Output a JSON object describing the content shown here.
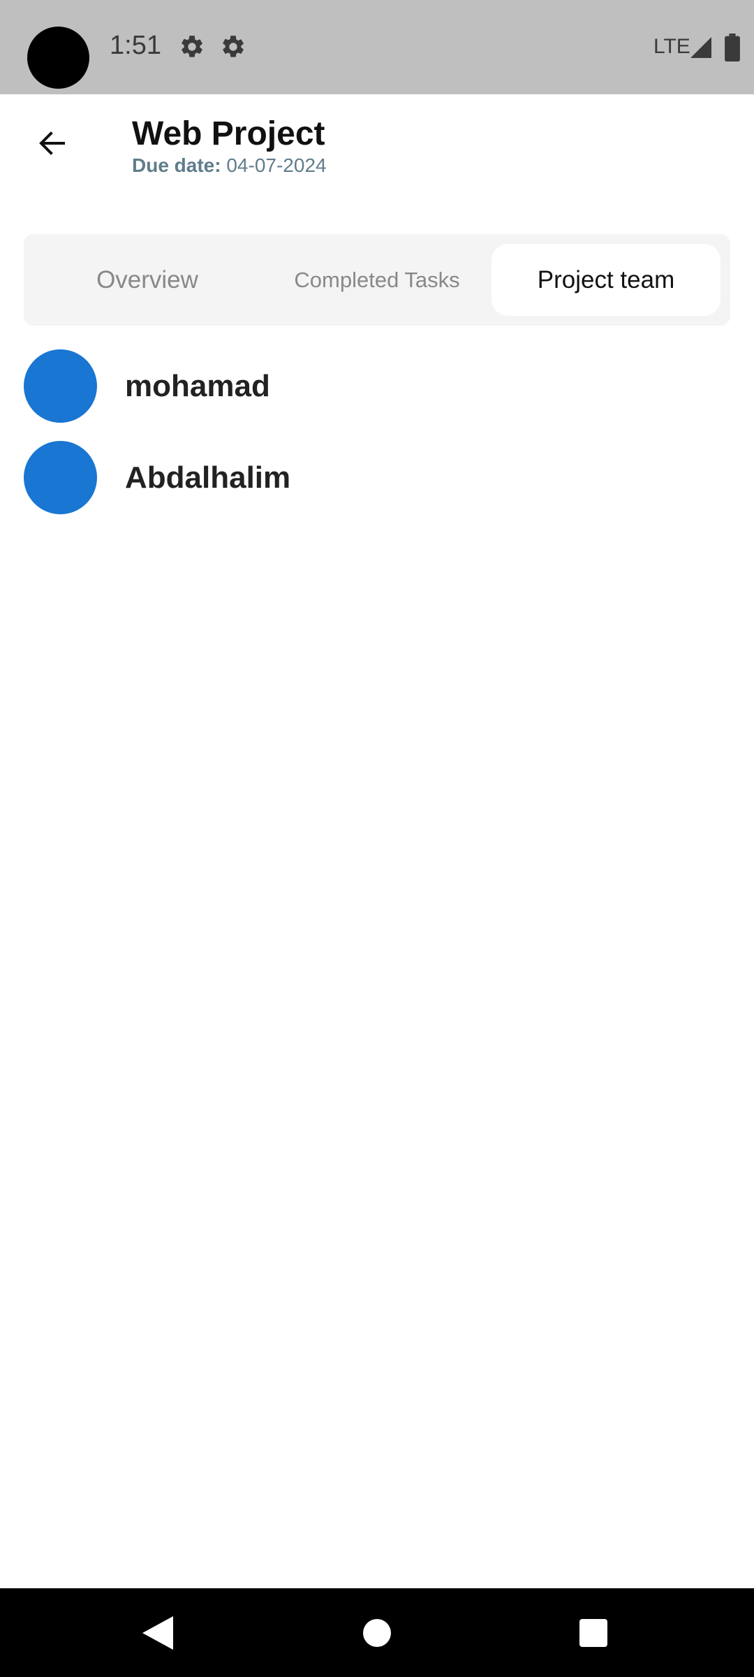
{
  "status_bar": {
    "time": "1:51",
    "network": "LTE",
    "icons": [
      "settings-icon",
      "settings-icon",
      "signal-icon",
      "battery-icon"
    ]
  },
  "header": {
    "title": "Web Project",
    "due_label": "Due date:",
    "due_value": "04-07-2024",
    "back_icon": "arrow-left-icon"
  },
  "tabs": [
    {
      "label": "Overview",
      "selected": false
    },
    {
      "label": "Completed Tasks",
      "selected": false
    },
    {
      "label": "Project team",
      "selected": true
    }
  ],
  "team": {
    "members": [
      {
        "name": "mohamad"
      },
      {
        "name": "Abdalhalim"
      }
    ]
  },
  "nav_bar": {
    "icons": [
      "nav-back-icon",
      "nav-home-icon",
      "nav-recents-icon"
    ]
  },
  "colors": {
    "status_bar_bg": "#bfbfbf",
    "avatar": "#1976d2",
    "due_text": "#607d8b",
    "tabbar_bg": "#f4f4f4",
    "nav_bar_bg": "#000000"
  }
}
